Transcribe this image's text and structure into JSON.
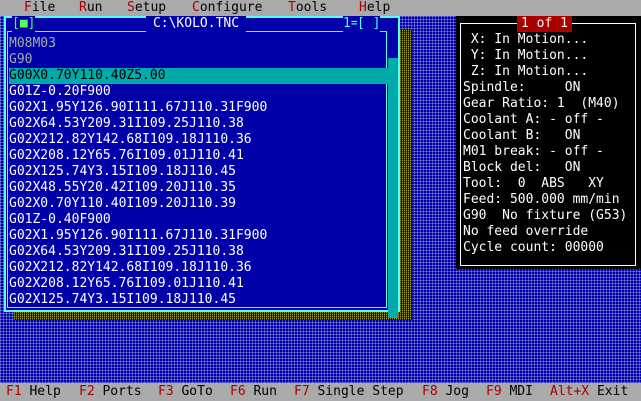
{
  "menu": {
    "items": [
      {
        "hot": "F",
        "rest": "ile"
      },
      {
        "hot": "R",
        "rest": "un"
      },
      {
        "hot": "S",
        "rest": "etup"
      },
      {
        "hot": "C",
        "rest": "onfigure"
      },
      {
        "hot": "T",
        "rest": "ools"
      },
      {
        "hot": "H",
        "rest": "elp"
      }
    ]
  },
  "editor": {
    "close_box": "[■]",
    "title": "C:\\KOLO.TNC",
    "window_number": "1=",
    "zoom_box": "[ ]",
    "lines": [
      "M08M03",
      "G90",
      "G00X0.70Y110.40Z5.00",
      "G01Z-0.20F900",
      "G02X1.95Y126.90I111.67J110.31F900",
      "G02X64.53Y209.31I109.25J110.38",
      "G02X212.82Y142.68I109.18J110.36",
      "G02X208.12Y65.76I109.01J110.41",
      "G02X125.74Y3.15I109.18J110.45",
      "G02X48.55Y20.42I109.20J110.35",
      "G02X0.70Y110.40I109.20J110.39",
      "G01Z-0.40F900",
      "G02X1.95Y126.90I111.67J110.31F900",
      "G02X64.53Y209.31I109.25J110.38",
      "G02X212.82Y142.68I109.18J110.36",
      "G02X208.12Y65.76I109.01J110.41",
      "G02X125.74Y3.15I109.18J110.45"
    ],
    "selected_line": 2
  },
  "status": {
    "badge": "1 of 1",
    "lines": [
      " X: In Motion...",
      " Y: In Motion...",
      " Z: In Motion...",
      "Spindle:     ON",
      "Gear Ratio: 1  (M40)",
      "Coolant A: - off -",
      "Coolant B:   ON",
      "M01 break: - off -",
      "Block del:   ON",
      "Tool:  0  ABS   XY",
      "Feed: 500.000 mm/min",
      "G90  No fixture (G53)",
      "No feed override",
      "Cycle count: 00000"
    ]
  },
  "function_keys": [
    {
      "key": "F1",
      "label": " Help"
    },
    {
      "key": "F2",
      "label": " Ports"
    },
    {
      "key": "F3",
      "label": " GoTo"
    },
    {
      "key": "F6",
      "label": " Run"
    },
    {
      "key": "F7",
      "label": " Single Step"
    },
    {
      "key": "F8",
      "label": " Jog"
    },
    {
      "key": "F9",
      "label": " MDI"
    },
    {
      "key": "Alt+X",
      "label": " Exit"
    }
  ]
}
